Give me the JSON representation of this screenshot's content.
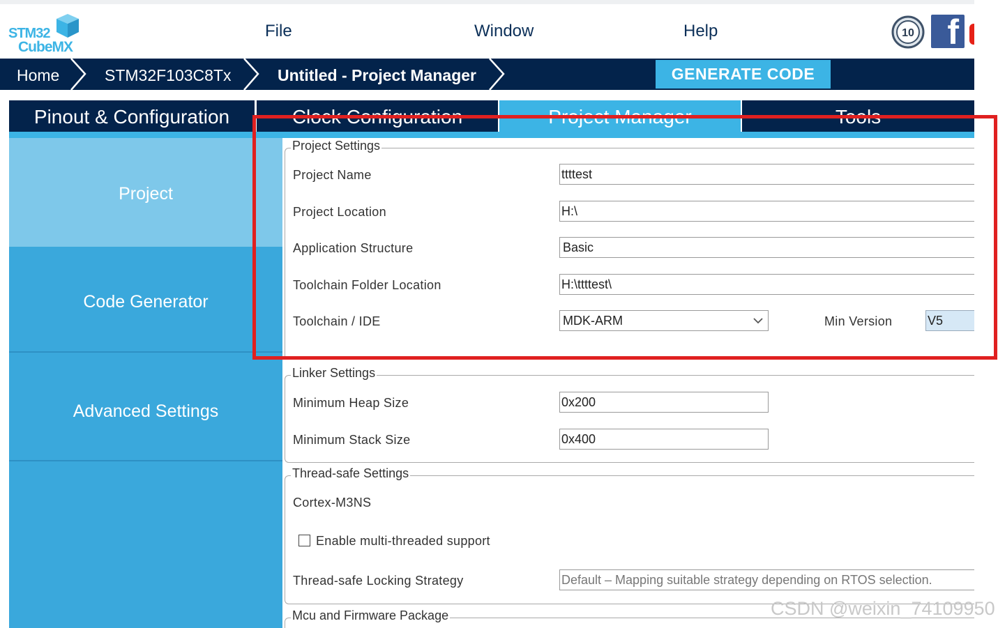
{
  "app": {
    "logo_line1": "STM32",
    "logo_line2": "CubeMX"
  },
  "menu": {
    "file": "File",
    "window": "Window",
    "help": "Help"
  },
  "icons": {
    "anniversary": "ten-year-badge-icon",
    "social": "facebook-icon",
    "video": "youtube-icon"
  },
  "breadcrumb": {
    "home": "Home",
    "device": "STM32F103C8Tx",
    "current": "Untitled - Project Manager"
  },
  "actions": {
    "generate_code": "GENERATE CODE"
  },
  "tabs": [
    {
      "label": "Pinout & Configuration",
      "active": false
    },
    {
      "label": "Clock Configuration",
      "active": false
    },
    {
      "label": "Project Manager",
      "active": true
    },
    {
      "label": "Tools",
      "active": false
    }
  ],
  "sidebar": {
    "items": [
      {
        "label": "Project",
        "active": true
      },
      {
        "label": "Code Generator",
        "active": false
      },
      {
        "label": "Advanced Settings",
        "active": false
      }
    ]
  },
  "project_settings": {
    "title": "Project Settings",
    "project_name_label": "Project Name",
    "project_name_value": "ttttest",
    "project_location_label": "Project Location",
    "project_location_value": "H:\\",
    "app_structure_label": "Application Structure",
    "app_structure_value": "Basic",
    "toolchain_folder_label": "Toolchain Folder Location",
    "toolchain_folder_value": "H:\\ttttest\\",
    "toolchain_ide_label": "Toolchain / IDE",
    "toolchain_ide_value": "MDK-ARM",
    "min_version_label": "Min Version",
    "min_version_value": "V5"
  },
  "linker_settings": {
    "title": "Linker Settings",
    "heap_label": "Minimum Heap Size",
    "heap_value": "0x200",
    "stack_label": "Minimum Stack Size",
    "stack_value": "0x400"
  },
  "thread_safe_settings": {
    "title": "Thread-safe Settings",
    "core": "Cortex-M3NS",
    "multithread_label": "Enable multi-threaded support",
    "multithread_checked": false,
    "locking_label": "Thread-safe Locking Strategy",
    "locking_value": "Default – Mapping suitable strategy depending on RTOS selection."
  },
  "mcu_firmware": {
    "title": "Mcu and Firmware Package"
  },
  "annotation": {
    "highlight_color": "#e02020"
  },
  "watermark": "CSDN @weixin_74109950",
  "colors": {
    "navy": "#03234b",
    "accent": "#3cb4e5",
    "sidebar": "#3aa8dc",
    "sidebar_active": "#7ec8ea"
  }
}
